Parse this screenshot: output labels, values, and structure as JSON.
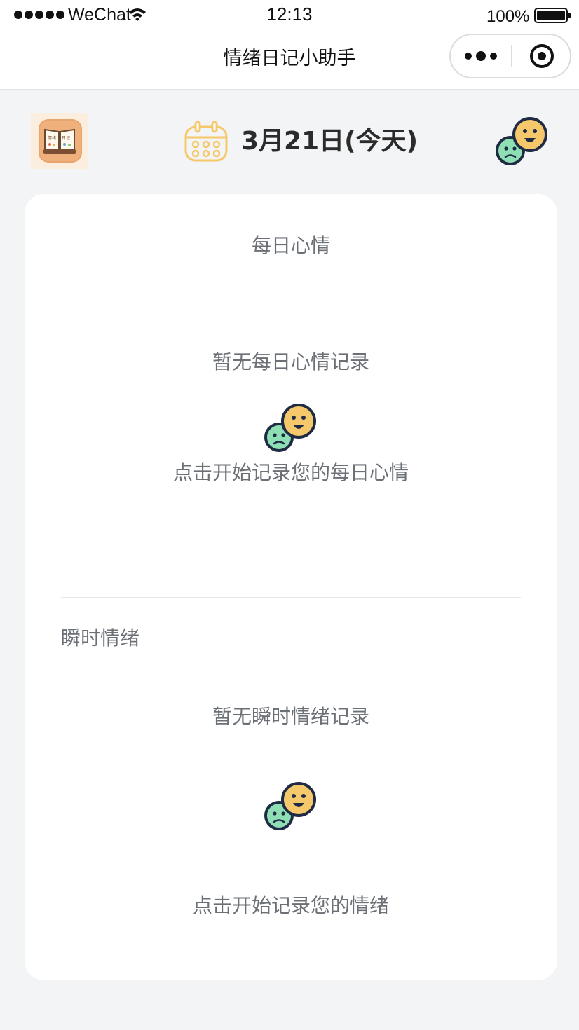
{
  "status_bar": {
    "carrier": "WeChat",
    "time": "12:13",
    "battery": "100%"
  },
  "nav": {
    "title": "情绪日记小助手"
  },
  "header": {
    "date": "3月21日(今天)"
  },
  "daily_mood": {
    "title": "每日心情",
    "empty_text": "暂无每日心情记录",
    "cta": "点击开始记录您的每日心情"
  },
  "instant_emotion": {
    "title": "瞬时情绪",
    "empty_text": "暂无瞬时情绪记录",
    "cta": "点击开始记录您的情绪"
  },
  "colors": {
    "accent_yellow": "#f5c86b",
    "accent_green": "#8ee0b4",
    "text_muted": "#6b6f76",
    "background": "#f3f4f6"
  },
  "icons": [
    "wifi-icon",
    "battery-icon",
    "more-icon",
    "close-icon",
    "app-logo-icon",
    "calendar-icon",
    "mood-faces-icon"
  ]
}
